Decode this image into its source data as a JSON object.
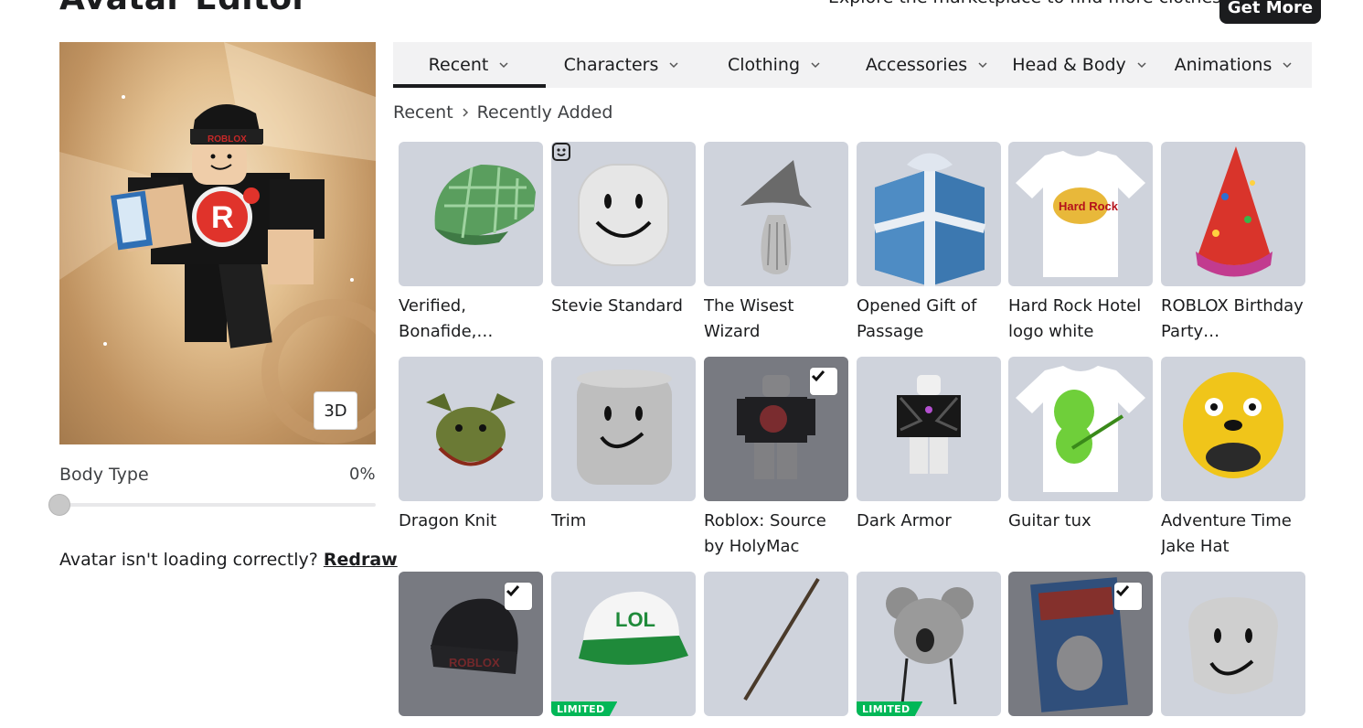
{
  "header": {
    "title": "Avatar Editor",
    "promo_text": "Explore the marketplace to find more clothes!",
    "get_more_label": "Get More"
  },
  "preview": {
    "view_toggle_label": "3D",
    "body_type_label": "Body Type",
    "body_type_value": "0%",
    "body_type_fraction": 0,
    "redraw_prompt": "Avatar isn't loading correctly?",
    "redraw_link": "Redraw"
  },
  "tabs": [
    {
      "label": "Recent",
      "active": true
    },
    {
      "label": "Characters",
      "active": false
    },
    {
      "label": "Clothing",
      "active": false
    },
    {
      "label": "Accessories",
      "active": false
    },
    {
      "label": "Head & Body",
      "active": false
    },
    {
      "label": "Animations",
      "active": false
    }
  ],
  "breadcrumb": {
    "root": "Recent",
    "current": "Recently Added"
  },
  "items": [
    {
      "name": "Verified, Bonafide,…",
      "icon": "green-plaid-cap-icon",
      "worn": false,
      "limited": false
    },
    {
      "name": "Stevie Standard",
      "icon": "smiling-head-icon",
      "worn": false,
      "limited": false,
      "emote": true
    },
    {
      "name": "The Wisest Wizard",
      "icon": "wizard-hat-icon",
      "worn": false,
      "limited": false
    },
    {
      "name": "Opened Gift of Passage",
      "icon": "gift-box-icon",
      "worn": false,
      "limited": false
    },
    {
      "name": "Hard Rock Hotel logo white",
      "icon": "t-shirt-icon",
      "worn": false,
      "limited": false
    },
    {
      "name": "ROBLOX Birthday Party…",
      "icon": "party-hat-icon",
      "worn": false,
      "limited": false
    },
    {
      "name": "Dragon Knit",
      "icon": "dragon-hat-icon",
      "worn": false,
      "limited": false
    },
    {
      "name": "Trim",
      "icon": "cylinder-head-icon",
      "worn": false,
      "limited": false
    },
    {
      "name": "Roblox: Source by HolyMac",
      "icon": "avatar-shirt-icon",
      "worn": true,
      "limited": false
    },
    {
      "name": "Dark Armor",
      "icon": "armor-avatar-icon",
      "worn": false,
      "limited": false
    },
    {
      "name": "Guitar tux",
      "icon": "guitar-shirt-icon",
      "worn": false,
      "limited": false
    },
    {
      "name": "Adventure Time Jake Hat",
      "icon": "jake-hat-icon",
      "worn": false,
      "limited": false
    },
    {
      "name": "",
      "icon": "black-beanie-icon",
      "worn": true,
      "limited": false
    },
    {
      "name": "",
      "icon": "lol-cap-icon",
      "worn": false,
      "limited": true
    },
    {
      "name": "",
      "icon": "wand-icon",
      "worn": false,
      "limited": false
    },
    {
      "name": "",
      "icon": "koala-hat-icon",
      "worn": false,
      "limited": true
    },
    {
      "name": "",
      "icon": "comic-book-icon",
      "worn": true,
      "limited": false
    },
    {
      "name": "",
      "icon": "smiling-head-icon",
      "worn": false,
      "limited": false
    }
  ],
  "badges": {
    "limited_label": "LIMITED"
  },
  "colors": {
    "accent": "#1b1c1e",
    "limited": "#02b757",
    "thumb_bg": "#cfd3dc"
  }
}
